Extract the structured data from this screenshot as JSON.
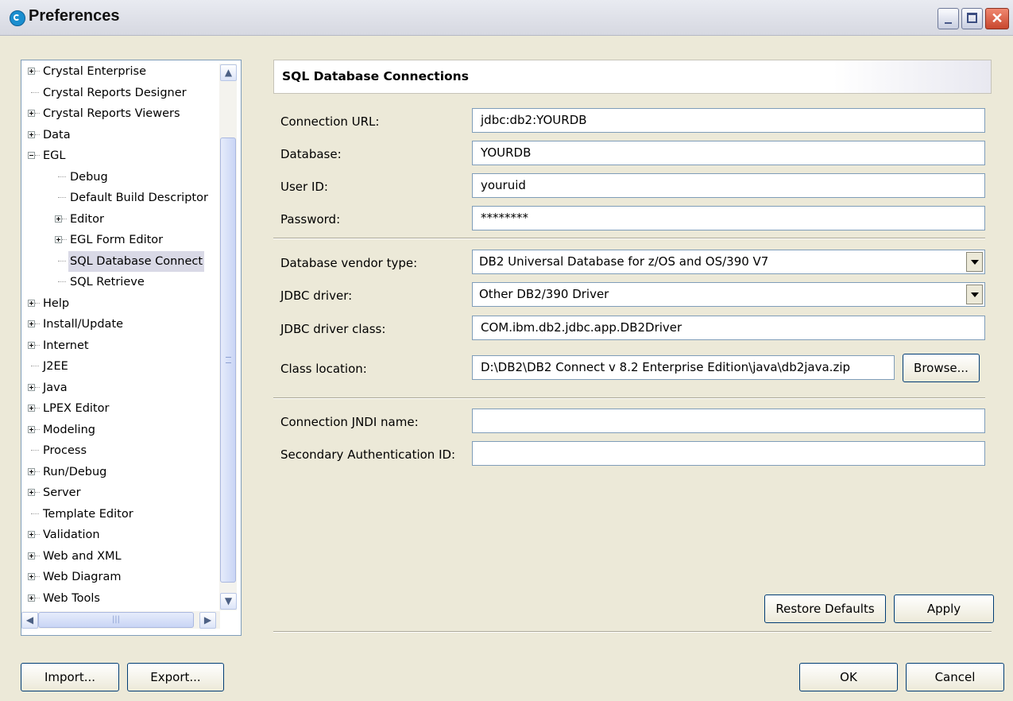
{
  "window": {
    "title": "Preferences",
    "close_glyph": "✕"
  },
  "tree": {
    "items": [
      {
        "label": "Crystal Enterprise",
        "expander": "plus"
      },
      {
        "label": "Crystal Reports Designer",
        "expander": "none"
      },
      {
        "label": "Crystal Reports Viewers",
        "expander": "plus"
      },
      {
        "label": "Data",
        "expander": "plus"
      },
      {
        "label": "EGL",
        "expander": "minus"
      },
      {
        "label": "Debug",
        "expander": "none"
      },
      {
        "label": "Default Build Descriptor",
        "expander": "none"
      },
      {
        "label": "Editor",
        "expander": "plus"
      },
      {
        "label": "EGL Form Editor",
        "expander": "plus"
      },
      {
        "label": "SQL Database Connect",
        "expander": "none",
        "selected": true
      },
      {
        "label": "SQL Retrieve",
        "expander": "none"
      },
      {
        "label": "Help",
        "expander": "plus"
      },
      {
        "label": "Install/Update",
        "expander": "plus"
      },
      {
        "label": "Internet",
        "expander": "plus"
      },
      {
        "label": "J2EE",
        "expander": "none"
      },
      {
        "label": "Java",
        "expander": "plus"
      },
      {
        "label": "LPEX Editor",
        "expander": "plus"
      },
      {
        "label": "Modeling",
        "expander": "plus"
      },
      {
        "label": "Process",
        "expander": "none"
      },
      {
        "label": "Run/Debug",
        "expander": "plus"
      },
      {
        "label": "Server",
        "expander": "plus"
      },
      {
        "label": "Template Editor",
        "expander": "none"
      },
      {
        "label": "Validation",
        "expander": "plus"
      },
      {
        "label": "Web and XML",
        "expander": "plus"
      },
      {
        "label": "Web Diagram",
        "expander": "plus"
      },
      {
        "label": "Web Tools",
        "expander": "plus"
      }
    ]
  },
  "page": {
    "title": "SQL Database Connections",
    "connection_url_label": "Connection URL:",
    "connection_url_value": "jdbc:db2:YOURDB",
    "database_label": "Database:",
    "database_value": "YOURDB",
    "user_id_label": "User ID:",
    "user_id_value": "youruid",
    "password_label": "Password:",
    "password_value": "********",
    "vendor_label": "Database vendor type:",
    "vendor_value": "DB2 Universal Database for z/OS and OS/390 V7",
    "driver_label": "JDBC driver:",
    "driver_value": "Other DB2/390 Driver",
    "driver_class_label": "JDBC driver class:",
    "driver_class_value": "COM.ibm.db2.jdbc.app.DB2Driver",
    "class_location_label": "Class location:",
    "class_location_value": "D:\\DB2\\DB2 Connect v 8.2 Enterprise Edition\\java\\db2java.zip",
    "browse_label": "Browse...",
    "jndi_label": "Connection JNDI name:",
    "jndi_value": "",
    "secondary_auth_label": "Secondary Authentication ID:",
    "secondary_auth_value": "",
    "restore_defaults_label": "Restore Defaults",
    "apply_label": "Apply"
  },
  "footer": {
    "import_label": "Import...",
    "export_label": "Export...",
    "ok_label": "OK",
    "cancel_label": "Cancel"
  }
}
